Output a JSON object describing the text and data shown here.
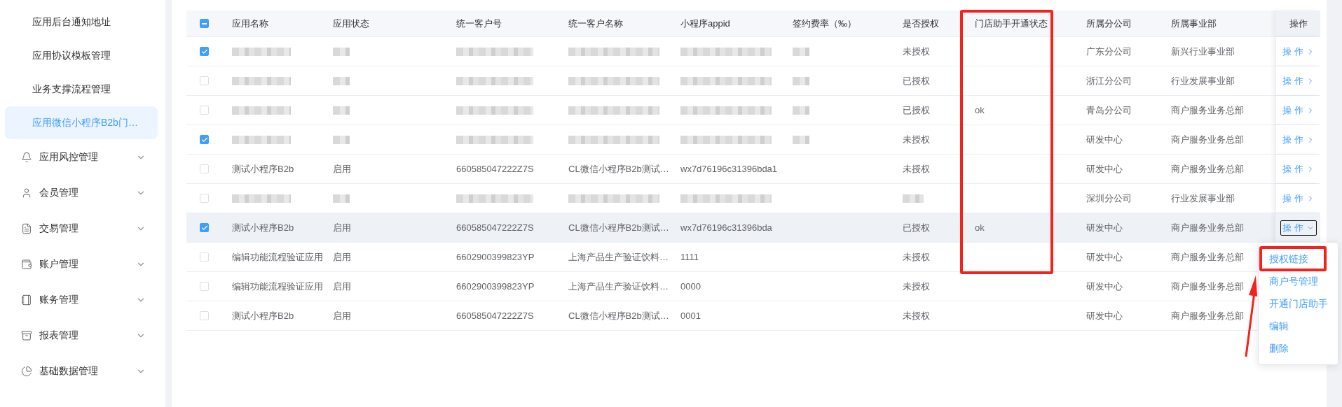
{
  "sidebar": {
    "sub_items": [
      {
        "label": "应用后台通知地址",
        "selected": false
      },
      {
        "label": "应用协议模板管理",
        "selected": false
      },
      {
        "label": "业务支撑流程管理",
        "selected": false
      },
      {
        "label": "应用微信小程序B2b门…",
        "selected": true
      }
    ],
    "groups": [
      {
        "label": "应用风控管理",
        "expanded": false
      },
      {
        "label": "会员管理",
        "expanded": false
      },
      {
        "label": "交易管理",
        "expanded": false
      },
      {
        "label": "账户管理",
        "expanded": false
      },
      {
        "label": "账务管理",
        "expanded": false
      },
      {
        "label": "报表管理",
        "expanded": false
      },
      {
        "label": "基础数据管理",
        "expanded": false
      }
    ]
  },
  "table": {
    "select_all": {
      "checked": true,
      "indeterminate": true
    },
    "columns": [
      "应用名称",
      "应用状态",
      "统一客户号",
      "统一客户名称",
      "小程序appid",
      "签约费率（‰）",
      "是否授权",
      "门店助手开通状态",
      "所属分公司",
      "所属事业部",
      "操作"
    ],
    "rows": [
      {
        "selected": true,
        "highlighted": false,
        "cells": [
          {
            "kind": "blurred"
          },
          {
            "kind": "blurred"
          },
          {
            "kind": "blurred"
          },
          {
            "kind": "blurred"
          },
          {
            "kind": "blurred"
          },
          {
            "kind": "blurred"
          },
          "未授权",
          null,
          "广东分公司",
          "新兴行业事业部"
        ],
        "action": {
          "label": "操作",
          "expanded": false
        }
      },
      {
        "selected": false,
        "highlighted": false,
        "cells": [
          {
            "kind": "blurred"
          },
          {
            "kind": "blurred"
          },
          {
            "kind": "blurred"
          },
          {
            "kind": "blurred"
          },
          {
            "kind": "blurred"
          },
          {
            "kind": "blurred"
          },
          "已授权",
          null,
          "浙江分公司",
          "行业发展事业部"
        ],
        "action": {
          "label": "操作",
          "expanded": false
        }
      },
      {
        "selected": false,
        "highlighted": false,
        "cells": [
          {
            "kind": "blurred"
          },
          {
            "kind": "blurred"
          },
          {
            "kind": "blurred"
          },
          {
            "kind": "blurred"
          },
          {
            "kind": "blurred"
          },
          {
            "kind": "blurred"
          },
          "已授权",
          "ok",
          "青岛分公司",
          "商户服务业务总部"
        ],
        "action": {
          "label": "操作",
          "expanded": false
        }
      },
      {
        "selected": true,
        "highlighted": false,
        "cells": [
          {
            "kind": "blurred"
          },
          {
            "kind": "blurred"
          },
          {
            "kind": "blurred"
          },
          {
            "kind": "blurred"
          },
          {
            "kind": "blurred"
          },
          {
            "kind": "blurred"
          },
          "未授权",
          null,
          "研发中心",
          "商户服务业务总部"
        ],
        "action": {
          "label": "操作",
          "expanded": false
        }
      },
      {
        "selected": false,
        "highlighted": false,
        "cells": [
          "测试小程序B2b",
          "启用",
          "660585047222Z7S",
          "CL微信小程序B2b测试…",
          "wx7d76196c31396bda1",
          null,
          "未授权",
          null,
          "研发中心",
          "商户服务业务总部"
        ],
        "action": {
          "label": "操作",
          "expanded": false
        }
      },
      {
        "selected": false,
        "highlighted": false,
        "cells": [
          {
            "kind": "blurred"
          },
          {
            "kind": "blurred"
          },
          {
            "kind": "blurred"
          },
          {
            "kind": "blurred"
          },
          {
            "kind": "blurred"
          },
          null,
          {
            "kind": "blurred"
          },
          null,
          "深圳分公司",
          "行业发展事业部"
        ],
        "action": {
          "label": "操作",
          "expanded": false
        }
      },
      {
        "selected": true,
        "highlighted": true,
        "cells": [
          "测试小程序B2b",
          "启用",
          "660585047222Z7S",
          "CL微信小程序B2b测试…",
          "wx7d76196c31396bda",
          null,
          "已授权",
          "ok",
          "研发中心",
          "商户服务业务总部"
        ],
        "action": {
          "label": "操作",
          "expanded": true
        }
      },
      {
        "selected": false,
        "highlighted": false,
        "cells": [
          "编辑功能流程验证应用",
          "启用",
          "6602900399823YP",
          "上海产品生产验证饮料…",
          "1111",
          null,
          "未授权",
          null,
          "研发中心",
          "商户服务业务总部"
        ],
        "action": null
      },
      {
        "selected": false,
        "highlighted": false,
        "cells": [
          "编辑功能流程验证应用",
          "启用",
          "6602900399823YP",
          "上海产品生产验证饮料…",
          "0000",
          null,
          "未授权",
          null,
          "研发中心",
          "商户服务业务总部"
        ],
        "action": null
      },
      {
        "selected": false,
        "highlighted": false,
        "cells": [
          "测试小程序B2b",
          "启用",
          "660585047222Z7S",
          "CL微信小程序B2b测试…",
          "0001",
          null,
          "未授权",
          null,
          "研发中心",
          "商户服务业务总部"
        ],
        "action": null
      }
    ]
  },
  "action_menu": {
    "items": [
      "授权链接",
      "商户号管理",
      "开通门店助手",
      "编辑",
      "删除"
    ]
  }
}
